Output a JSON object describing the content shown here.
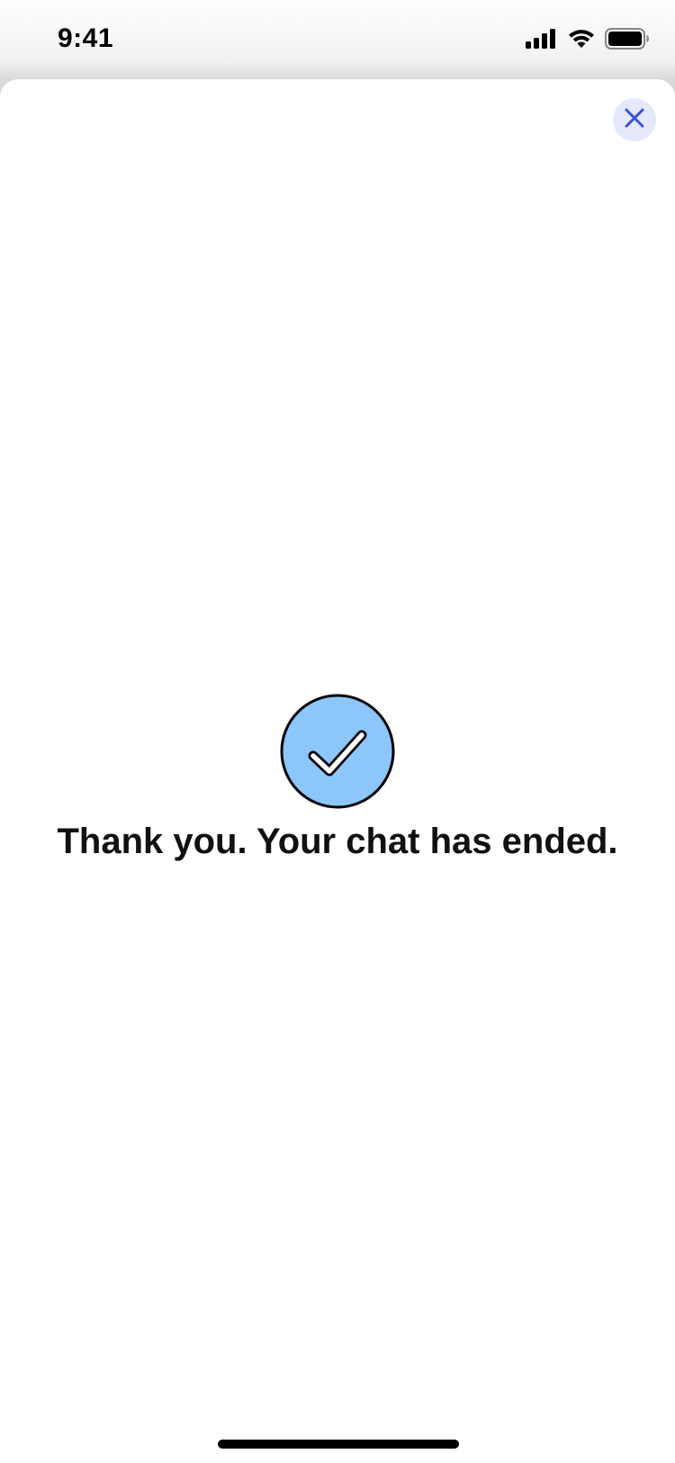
{
  "status_bar": {
    "time": "9:41",
    "icons": [
      "cellular-signal-icon",
      "wifi-icon",
      "battery-icon"
    ]
  },
  "header": {
    "close_icon": "close-icon"
  },
  "main": {
    "icon": "checkmark-circle-icon",
    "message": "Thank you. Your chat has ended."
  },
  "colors": {
    "accent": "#3d4fe0",
    "close_bg": "#e5e9fb",
    "check_fill": "#8dc6fa",
    "text": "#111111"
  }
}
